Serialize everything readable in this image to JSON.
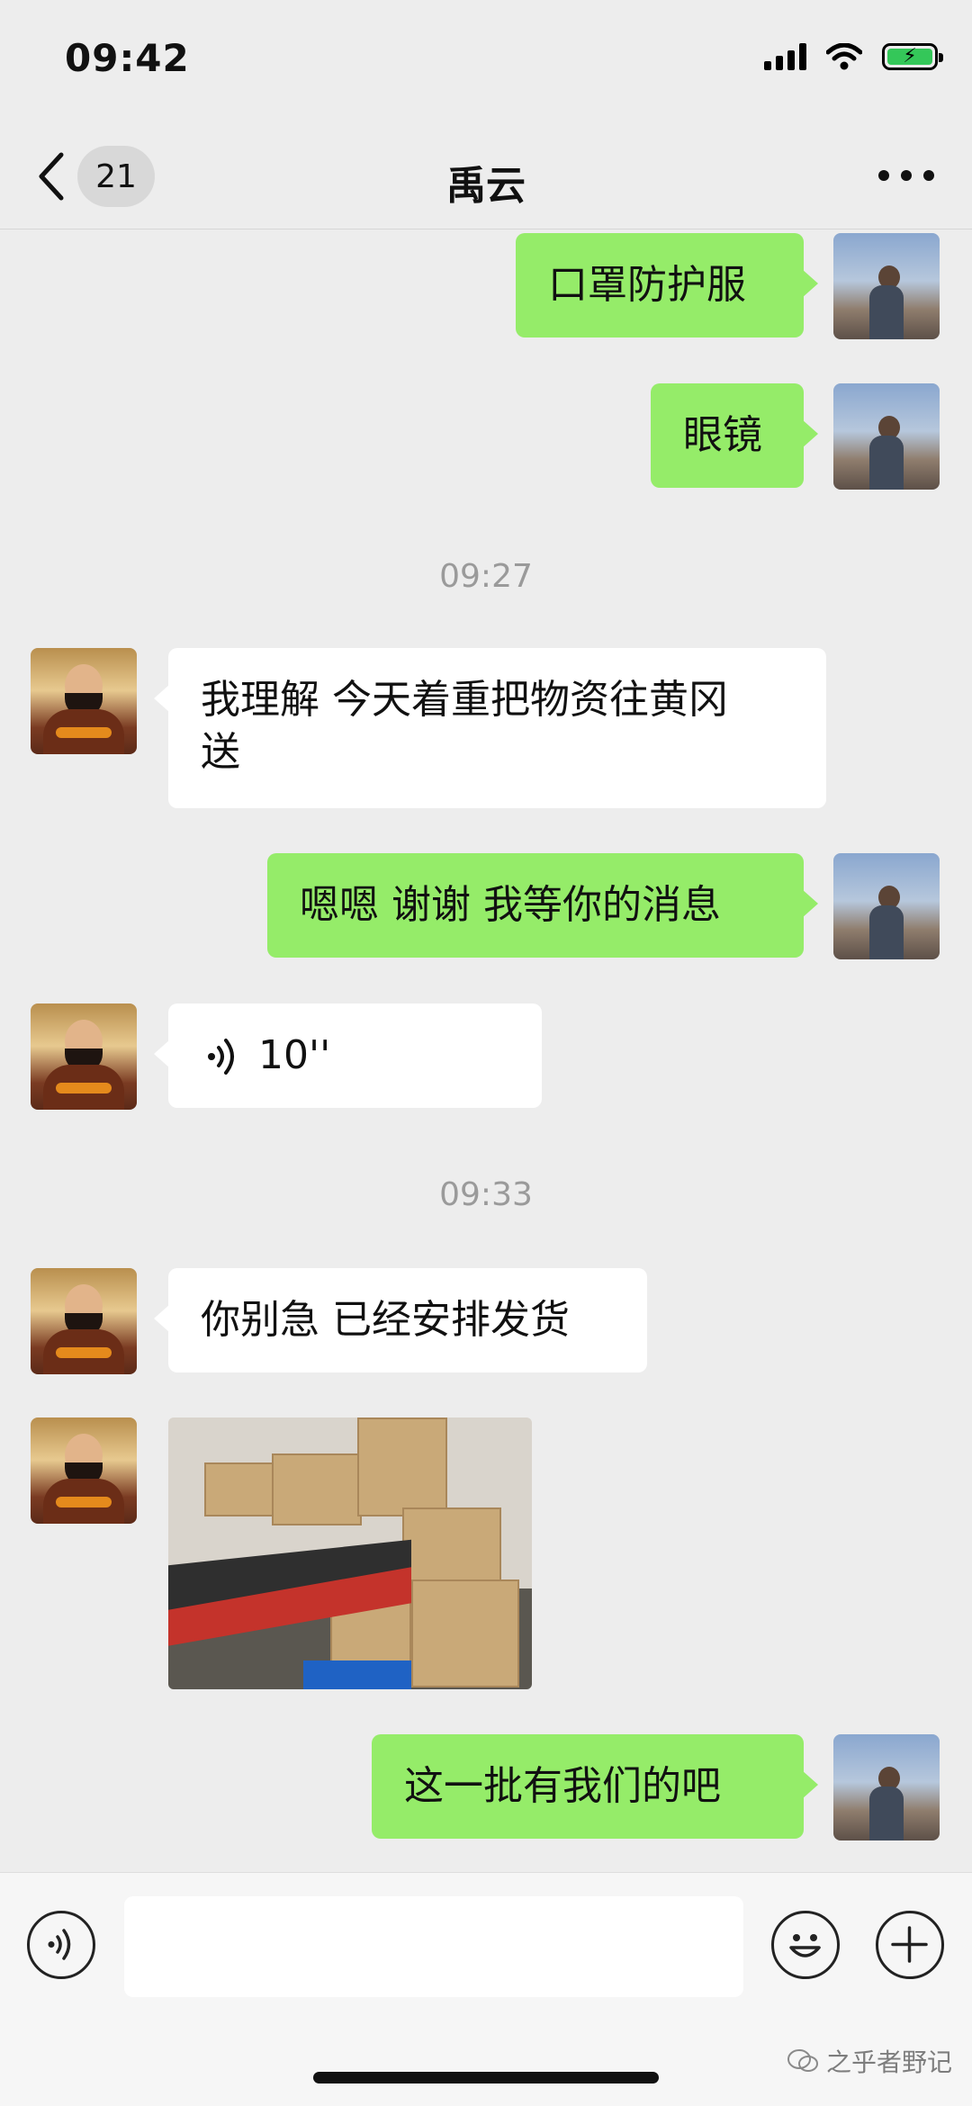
{
  "status_bar": {
    "time": "09:42"
  },
  "nav": {
    "back_count": "21",
    "title": "禹云"
  },
  "messages": [
    {
      "type": "text",
      "from": "me",
      "text": "口罩防护服"
    },
    {
      "type": "text",
      "from": "me",
      "text": "眼镜"
    },
    {
      "type": "timestamp",
      "text": "09:27"
    },
    {
      "type": "text",
      "from": "them",
      "text": "我理解 今天着重把物资往黄冈\n送"
    },
    {
      "type": "text",
      "from": "me",
      "text": "嗯嗯 谢谢 我等你的消息"
    },
    {
      "type": "voice",
      "from": "them",
      "duration": "10''"
    },
    {
      "type": "timestamp",
      "text": "09:33"
    },
    {
      "type": "text",
      "from": "them",
      "text": "你别急 已经安排发货"
    },
    {
      "type": "image",
      "from": "them",
      "description": "warehouse-boxes-photo"
    },
    {
      "type": "text",
      "from": "me",
      "text": "这一批有我们的吧"
    }
  ],
  "input": {
    "value": "",
    "placeholder": ""
  },
  "watermark": "之乎者野记",
  "colors": {
    "background": "#ededed",
    "my_bubble": "#95ec69",
    "their_bubble": "#ffffff",
    "timestamp": "#9a9a9a"
  },
  "icons": [
    "signal-icon",
    "wifi-icon",
    "battery-icon",
    "back-chevron-icon",
    "more-icon",
    "voice-icon",
    "emoji-icon",
    "plus-icon"
  ]
}
